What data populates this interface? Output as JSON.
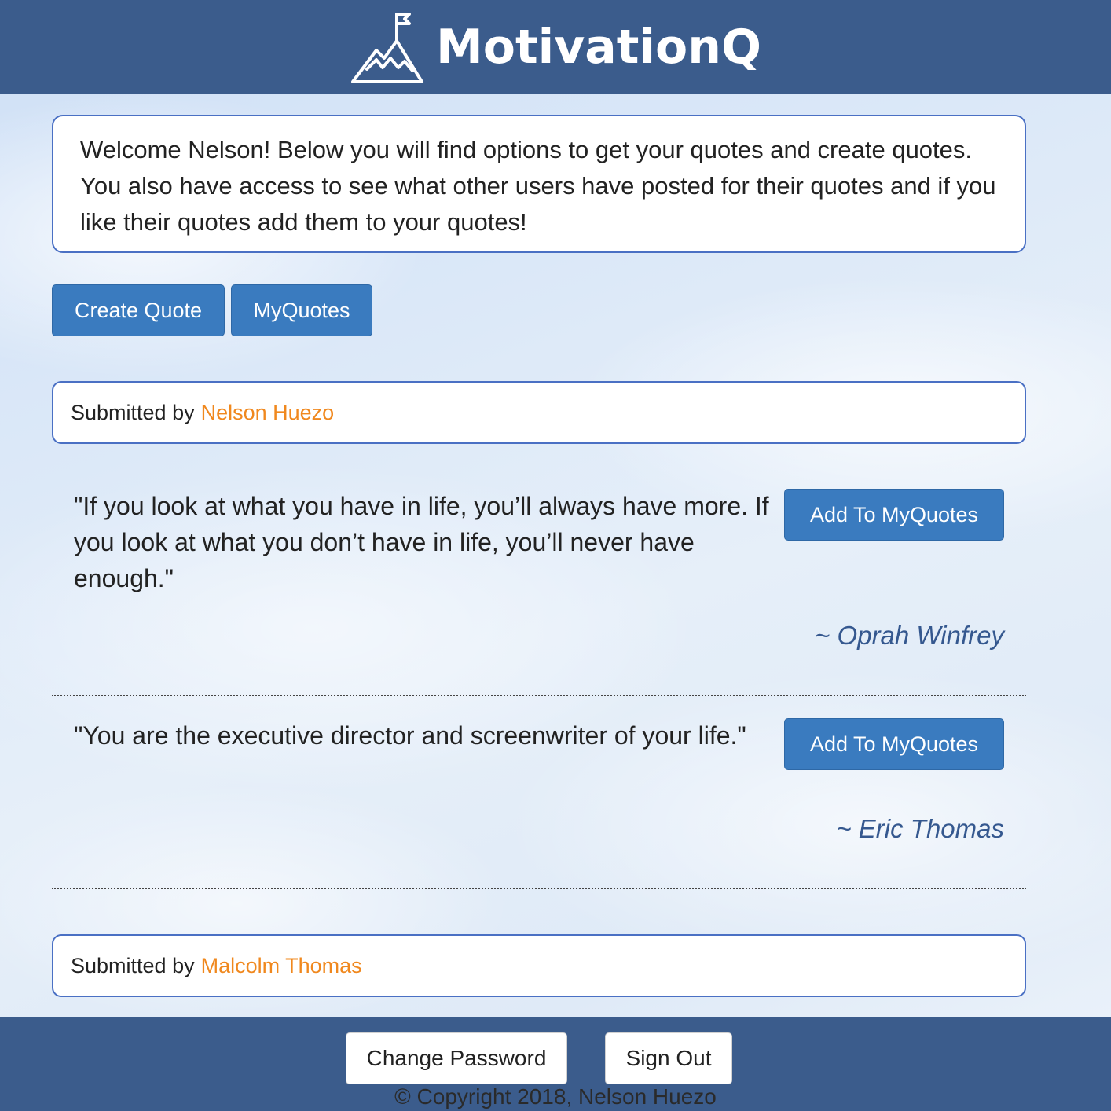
{
  "header": {
    "brand": "MotivationQ",
    "logo_icon": "mountain-flag-icon"
  },
  "welcome": {
    "text": "Welcome Nelson! Below you will find options to get your quotes and create quotes. You also have access to see what other users have posted for their quotes and if you like their quotes add them to your quotes!"
  },
  "actions": {
    "create_quote": "Create Quote",
    "my_quotes": "MyQuotes"
  },
  "submissions": [
    {
      "label": "Submitted by",
      "name": "Nelson Huezo",
      "quotes": [
        {
          "text": "\"If you look at what you have in life, you’ll always have more. If you look at what you don’t have in life, you’ll never have enough.\"",
          "author": "~ Oprah Winfrey",
          "add_label": "Add To MyQuotes"
        },
        {
          "text": "\"You are the executive director and screenwriter of your life.\"",
          "author": "~ Eric Thomas",
          "add_label": "Add To MyQuotes"
        }
      ]
    },
    {
      "label": "Submitted by",
      "name": "Malcolm Thomas"
    }
  ],
  "footer": {
    "change_password": "Change Password",
    "sign_out": "Sign Out",
    "copyright": "© Copyright 2018, Nelson Huezo"
  },
  "colors": {
    "header_bg": "#3b5c8c",
    "primary_button": "#3a7bbf",
    "submitter_name": "#f0881e",
    "author": "#35588f",
    "box_border": "#4a70c4"
  }
}
